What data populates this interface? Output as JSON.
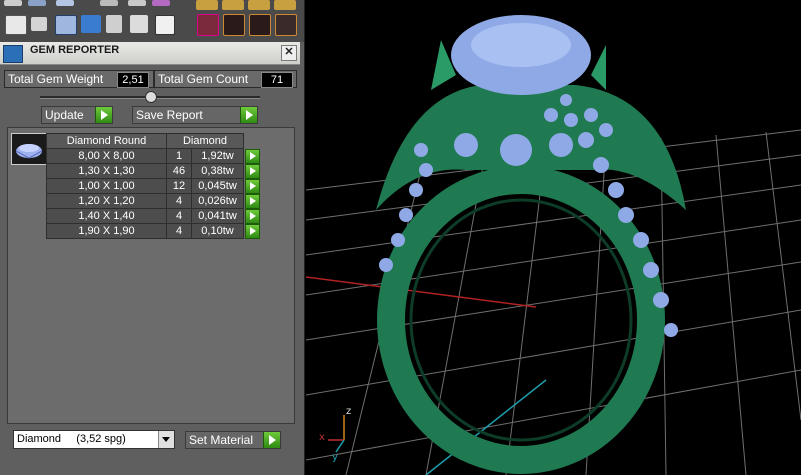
{
  "panel": {
    "title": "GEM REPORTER",
    "close_glyph": "✕",
    "total_weight_label": "Total Gem Weight",
    "total_weight_value": "2,51",
    "total_count_label": "Total Gem Count",
    "total_count_value": "71",
    "update_label": "Update",
    "save_report_label": "Save Report",
    "table": {
      "headers": [
        "Diamond Round",
        "Diamond"
      ],
      "rows": [
        {
          "size": "8,00 X 8,00",
          "count": "1",
          "weight": "1,92tw"
        },
        {
          "size": "1,30 X 1,30",
          "count": "46",
          "weight": "0,38tw"
        },
        {
          "size": "1,00 X 1,00",
          "count": "12",
          "weight": "0,045tw"
        },
        {
          "size": "1,20 X 1,20",
          "count": "4",
          "weight": "0,026tw"
        },
        {
          "size": "1,40 X 1,40",
          "count": "4",
          "weight": "0,041tw"
        },
        {
          "size": "1,90 X 1,90",
          "count": "4",
          "weight": "0,10tw"
        }
      ]
    },
    "material_select_value": "Diamond     (3,52 spg)",
    "set_material_label": "Set Material"
  },
  "viewport": {
    "axis_z": "z",
    "axis_x": "x",
    "axis_y": "y"
  },
  "colors": {
    "ring_green": "#1f7a52",
    "gem_blue": "#8fa9e6",
    "grid": "#7a7a7a",
    "play_green": "#4cae2a"
  }
}
